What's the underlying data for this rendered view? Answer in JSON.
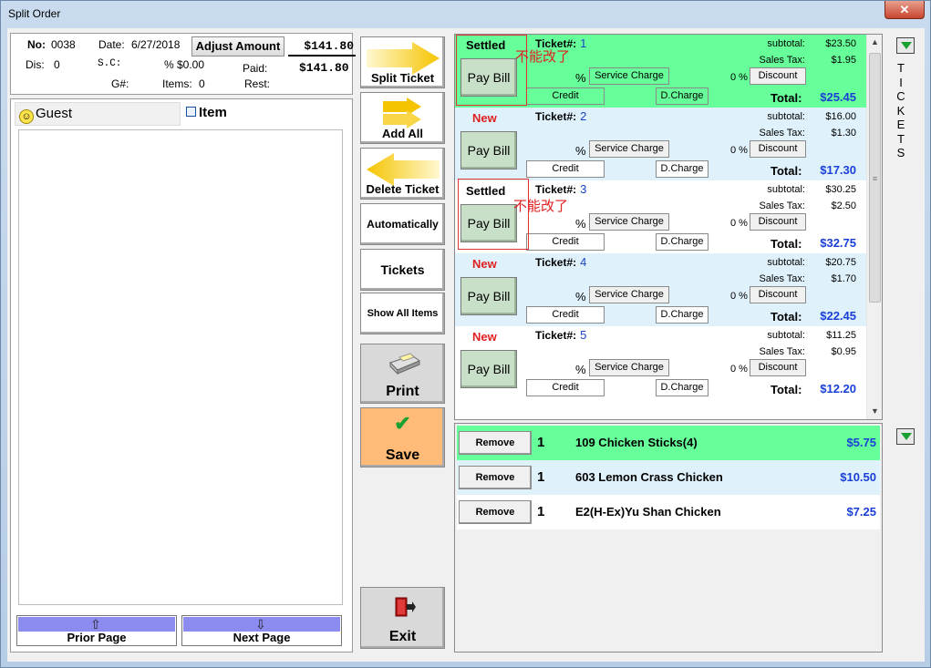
{
  "window": {
    "title": "Split Order",
    "close_label": "✕"
  },
  "header": {
    "no_label": "No:",
    "no_value": "0038",
    "date_label": "Date:",
    "date_value": "6/27/2018",
    "adjust_label": "Adjust Amount",
    "amount": "$141.80",
    "dis_label": "Dis:",
    "dis_value": "0",
    "sc_label": "S.C:",
    "pct_sc": "% $0.00",
    "paid_label": "Paid:",
    "paid_value": "$141.80",
    "g_label": "G#:",
    "items_label": "Items:",
    "items_value": "0",
    "rest_label": "Rest:"
  },
  "left": {
    "guest_tab": "Guest",
    "item_tab": "Item",
    "prior_label": "Prior Page",
    "next_label": "Next Page"
  },
  "actions": {
    "split_ticket": "Split Ticket",
    "add_all": "Add All",
    "delete_ticket": "Delete Ticket",
    "automatically": "Automatically",
    "tickets": "Tickets",
    "show_all_items": "Show All Items",
    "print": "Print",
    "save": "Save",
    "exit": "Exit"
  },
  "ticket_labels": {
    "ticket": "Ticket#:",
    "subtotal": "subtotal:",
    "tax": "Sales Tax:",
    "pay_bill": "Pay Bill",
    "pct": "%",
    "service_charge": "Service Charge",
    "zero_pct": "0 %",
    "discount": "Discount",
    "credit": "Credit",
    "dcharge": "D.Charge",
    "total": "Total:"
  },
  "tickets": [
    {
      "status": "Settled",
      "number": "1",
      "subtotal": "$23.50",
      "tax": "$1.95",
      "total": "$25.45"
    },
    {
      "status": "New",
      "number": "2",
      "subtotal": "$16.00",
      "tax": "$1.30",
      "total": "$17.30"
    },
    {
      "status": "Settled",
      "number": "3",
      "subtotal": "$30.25",
      "tax": "$2.50",
      "total": "$32.75"
    },
    {
      "status": "New",
      "number": "4",
      "subtotal": "$20.75",
      "tax": "$1.70",
      "total": "$22.45"
    },
    {
      "status": "New",
      "number": "5",
      "subtotal": "$11.25",
      "tax": "$0.95",
      "total": "$12.20"
    }
  ],
  "annotations": {
    "note": "不能改了"
  },
  "items": [
    {
      "remove": "Remove",
      "qty": "1",
      "name": "109 Chicken Sticks(4)",
      "price": "$5.75"
    },
    {
      "remove": "Remove",
      "qty": "1",
      "name": "603 Lemon Crass Chicken",
      "price": "$10.50"
    },
    {
      "remove": "Remove",
      "qty": "1",
      "name": "E2(H-Ex)Yu Shan Chicken",
      "price": "$7.25"
    }
  ],
  "side": {
    "tickets_vertical": [
      "T",
      "I",
      "C",
      "K",
      "E",
      "T",
      "S"
    ]
  },
  "colors": {
    "settled_bg": "#66ff99",
    "alt_bg": "#dff1fb",
    "accent_blue": "#1a3fd8",
    "new_red": "#e02020",
    "save_bg": "#ffbb77"
  }
}
